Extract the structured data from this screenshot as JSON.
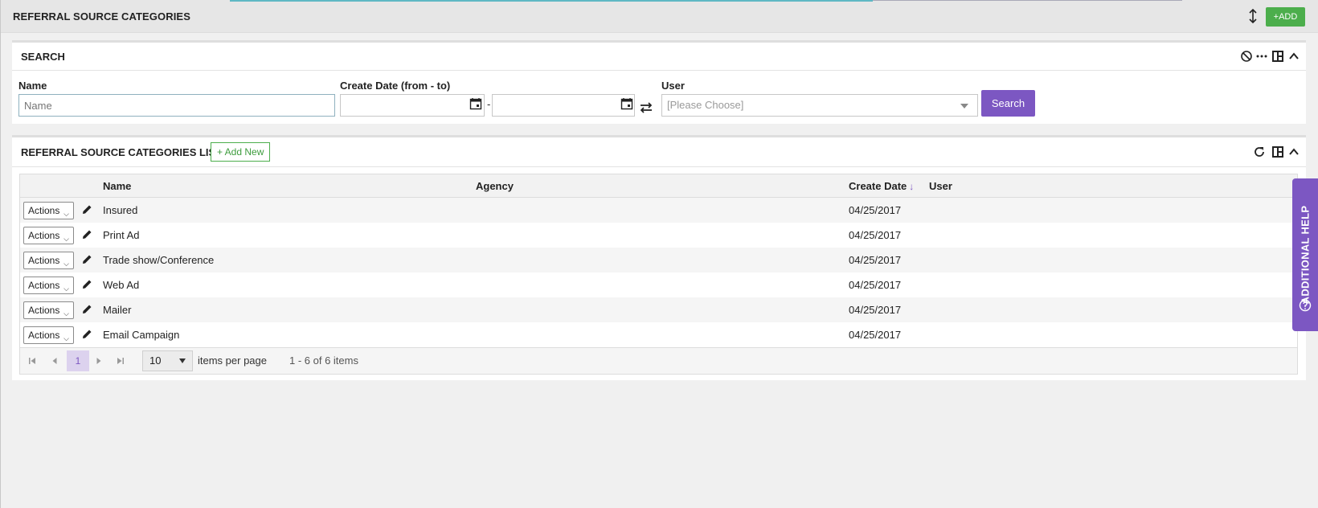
{
  "header": {
    "title": "REFERRAL SOURCE CATEGORIES",
    "add_label": "+ADD"
  },
  "search_panel": {
    "title": "SEARCH",
    "name_label": "Name",
    "name_placeholder": "Name",
    "date_label": "Create Date (from - to)",
    "date_separator": "-",
    "user_label": "User",
    "user_placeholder": "[Please Choose]",
    "search_button": "Search"
  },
  "list_panel": {
    "title": "REFERRAL SOURCE CATEGORIES LIST",
    "add_new_label": "+ Add New",
    "columns": {
      "name": "Name",
      "agency": "Agency",
      "create_date": "Create Date",
      "sort_arrow": "↓",
      "user": "User"
    },
    "actions_label": "Actions",
    "rows": [
      {
        "name": "Insured",
        "agency": "",
        "create_date": "04/25/2017",
        "user": ""
      },
      {
        "name": "Print Ad",
        "agency": "",
        "create_date": "04/25/2017",
        "user": ""
      },
      {
        "name": "Trade show/Conference",
        "agency": "",
        "create_date": "04/25/2017",
        "user": ""
      },
      {
        "name": "Web Ad",
        "agency": "",
        "create_date": "04/25/2017",
        "user": ""
      },
      {
        "name": "Mailer",
        "agency": "",
        "create_date": "04/25/2017",
        "user": ""
      },
      {
        "name": "Email Campaign",
        "agency": "",
        "create_date": "04/25/2017",
        "user": ""
      }
    ],
    "pager": {
      "current_page": "1",
      "per_page": "10",
      "per_page_label": "items per page",
      "summary": "1 - 6 of 6 items"
    }
  },
  "help_tab": {
    "label": "ADDITIONAL HELP"
  },
  "colors": {
    "accent_purple": "#7c57c2",
    "add_green": "#4cae4c",
    "background": "#f0f0f0"
  },
  "icons": [
    "sort-arrows-icon",
    "clear-filter-icon",
    "more-icon",
    "layout-icon",
    "collapse-icon",
    "calendar-icon",
    "swap-icon",
    "refresh-icon",
    "pencil-icon",
    "first-page-icon",
    "prev-page-icon",
    "next-page-icon",
    "last-page-icon",
    "help-circle-icon"
  ]
}
